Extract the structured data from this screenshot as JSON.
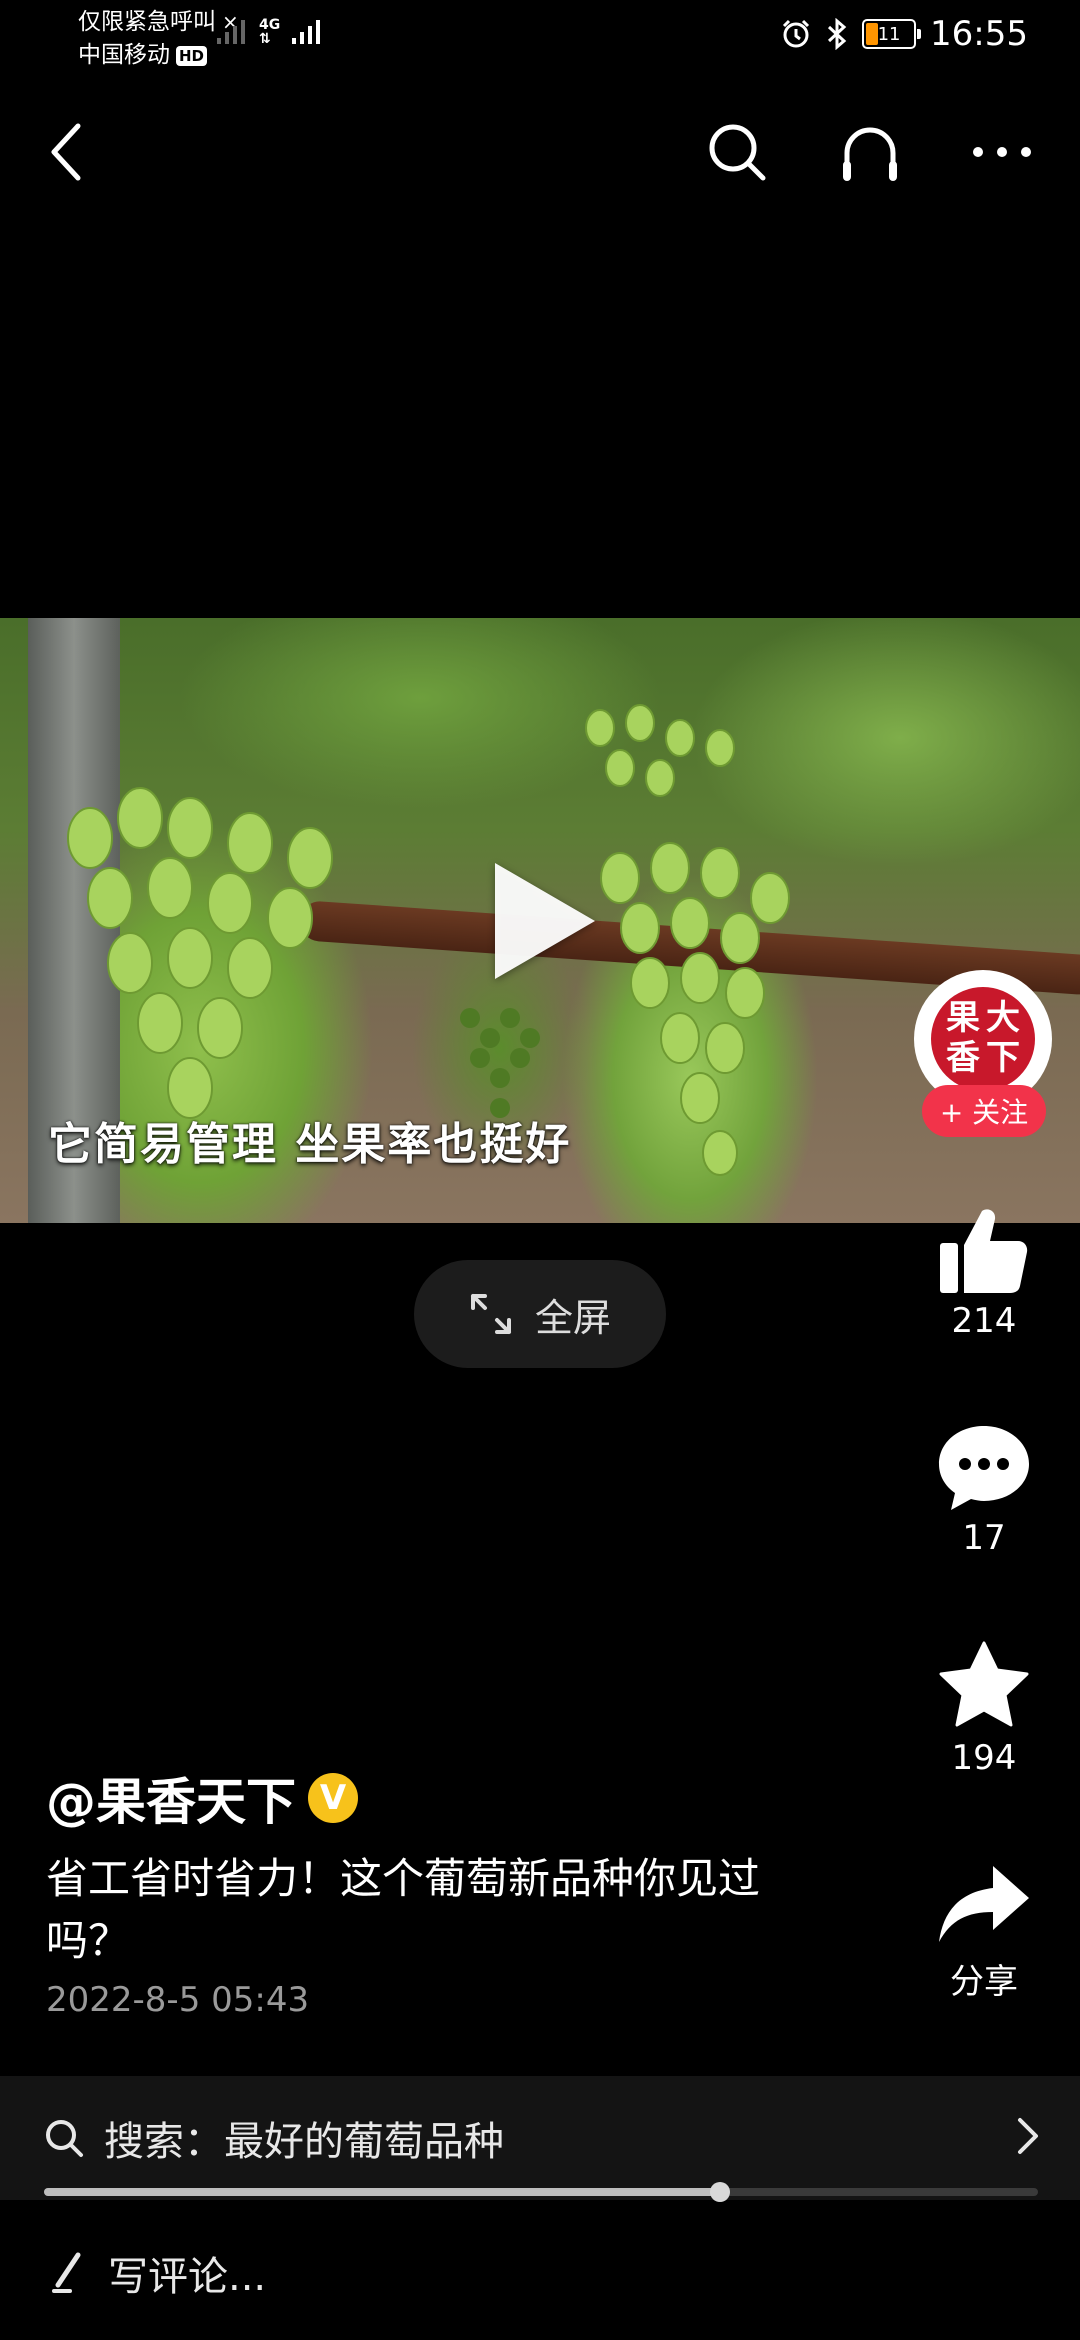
{
  "status_bar": {
    "emergency": "仅限紧急呼叫",
    "carrier": "中国移动",
    "hd": "HD",
    "network": "4G",
    "battery": "11",
    "time": "16:55"
  },
  "nav": {
    "back_icon": "back-arrow-icon",
    "search_icon": "search-icon",
    "listen_icon": "headphones-icon",
    "more_icon": "more-icon"
  },
  "video": {
    "subtitle": "它简易管理 坐果率也挺好",
    "progress_fraction": 0.68
  },
  "fullscreen": {
    "label": "全屏"
  },
  "rail": {
    "avatar_text": [
      "果",
      "大",
      "香",
      "下"
    ],
    "follow_label": "+ 关注",
    "likes": "214",
    "comments": "17",
    "favorites": "194",
    "share_label": "分享"
  },
  "post": {
    "author": "@果香天下",
    "verified": "V",
    "description": "省工省时省力！这个葡萄新品种你见过吗？",
    "date": "2022-8-5 05:43"
  },
  "search": {
    "label": "搜索：最好的葡萄品种"
  },
  "comment": {
    "placeholder": "写评论..."
  },
  "colors": {
    "accent": "#f2334a",
    "badge": "#f7c21b",
    "background": "#000000"
  }
}
